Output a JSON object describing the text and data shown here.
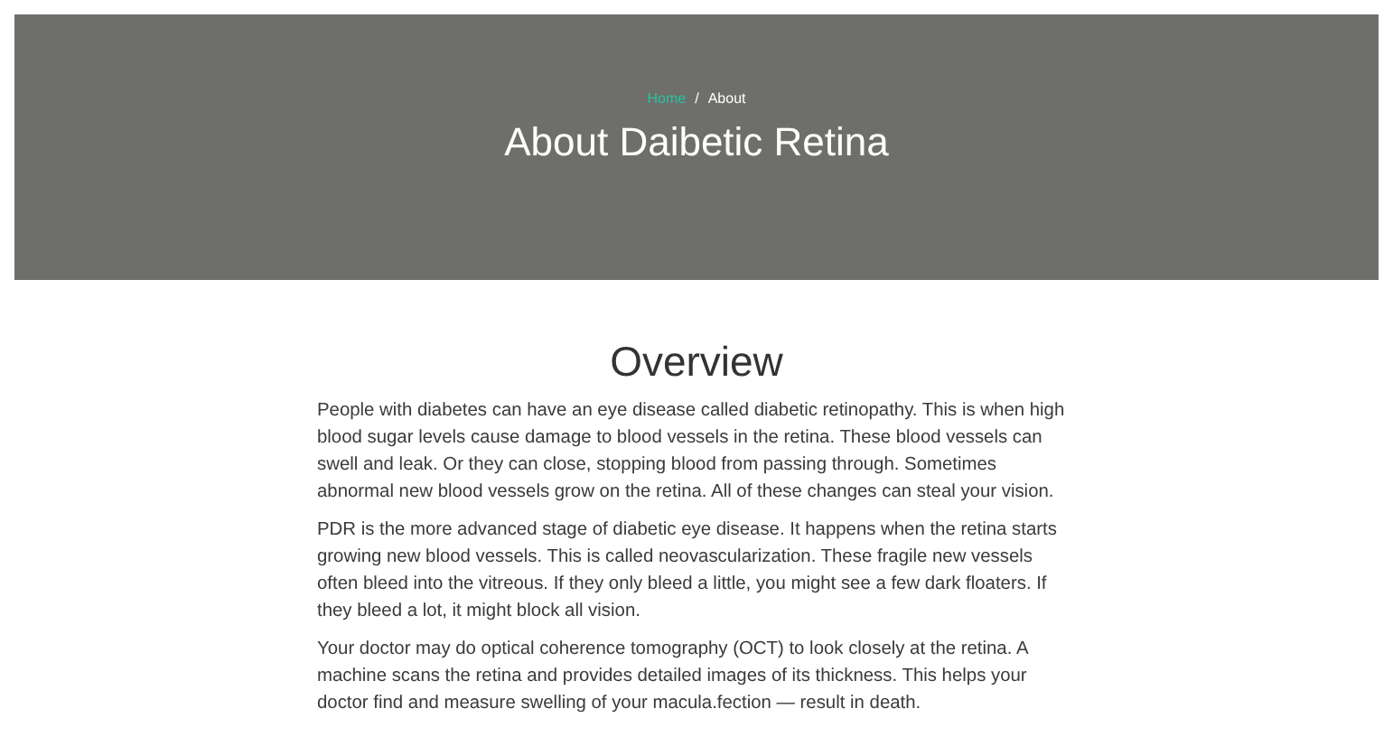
{
  "breadcrumb": [
    {
      "label": "Home",
      "kind": "link"
    },
    {
      "label": "About",
      "kind": "current"
    }
  ],
  "breadcrumb_separator": "/",
  "page_title": "About Daibetic Retina",
  "section": {
    "heading": "Overview",
    "paragraphs": [
      "People with diabetes can have an eye disease called diabetic retinopathy. This is when high blood sugar levels cause damage to blood vessels in the retina. These blood vessels can swell and leak. Or they can close, stopping blood from passing through. Sometimes abnormal new blood vessels grow on the retina. All of these changes can steal your vision.",
      "PDR is the more advanced stage of diabetic eye disease. It happens when the retina starts growing new blood vessels. This is called neovascularization. These fragile new vessels often bleed into the vitreous. If they only bleed a little, you might see a few dark floaters. If they bleed a lot, it might block all vision.",
      "Your doctor may do optical coherence tomography (OCT) to look closely at the retina. A machine scans the retina and provides detailed images of its thickness. This helps your doctor find and measure swelling of your macula.fection — result in death."
    ]
  }
}
